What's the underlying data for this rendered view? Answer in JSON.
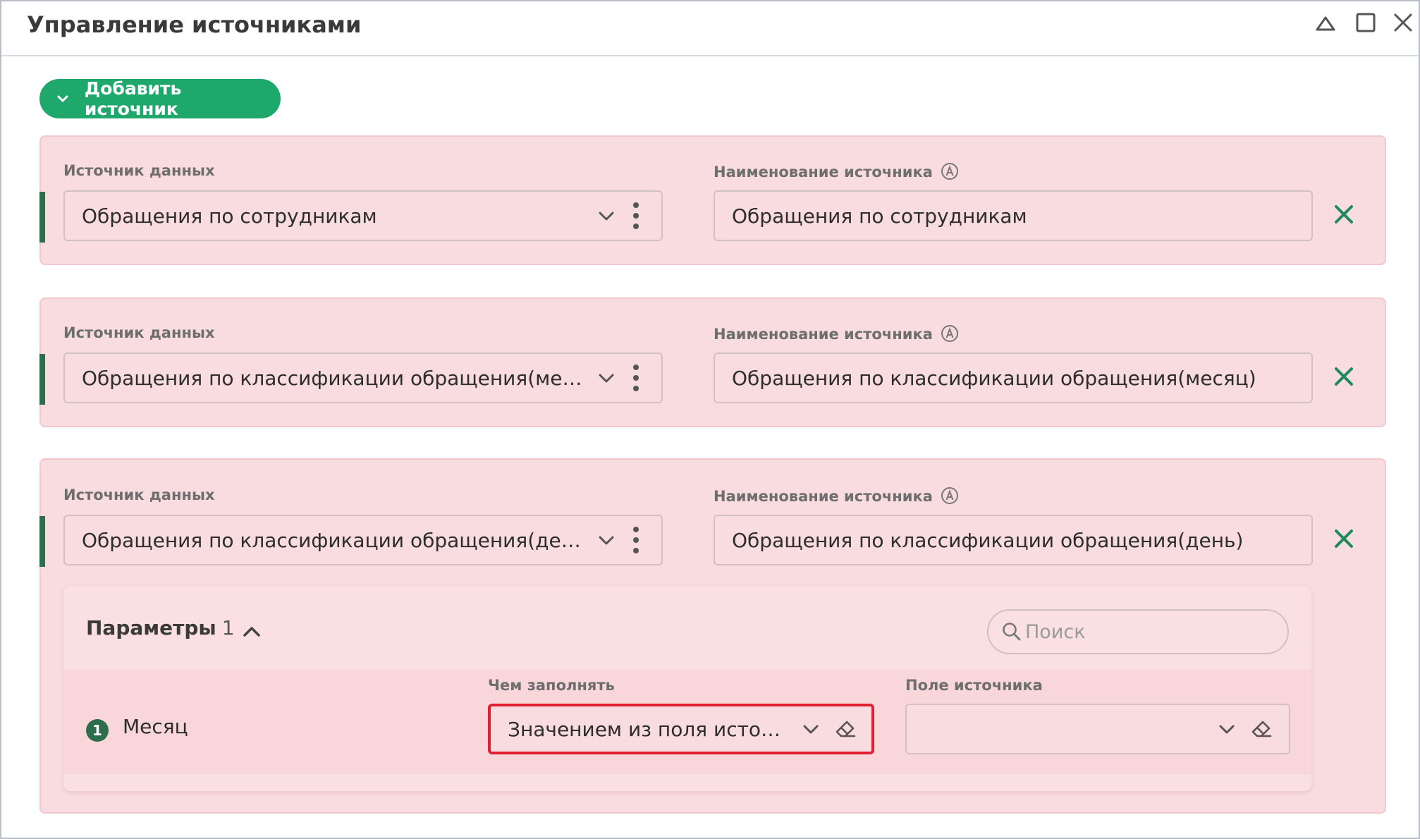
{
  "window": {
    "title": "Управление источниками"
  },
  "add_button": {
    "label": "Добавить источник"
  },
  "sources": [
    {
      "source_label": "Источник данных",
      "source_value": "Обращения по сотрудникам",
      "name_label": "Наименование источника",
      "name_value": "Обращения по сотрудникам"
    },
    {
      "source_label": "Источник данных",
      "source_value": "Обращения по классификации обращения(месяц)",
      "name_label": "Наименование источника",
      "name_value": "Обращения по классификации обращения(месяц)"
    },
    {
      "source_label": "Источник данных",
      "source_value": "Обращения по классификации обращения(день)",
      "name_label": "Наименование источника",
      "name_value": "Обращения по классификации обращения(день)"
    }
  ],
  "params": {
    "title": "Параметры",
    "count": "1",
    "search_placeholder": "Поиск",
    "fill_label": "Чем заполнять",
    "field_label": "Поле источника",
    "rows": [
      {
        "num": "1",
        "name": "Месяц",
        "fill_value": "Значением из поля источн…",
        "field_value": ""
      }
    ]
  },
  "colors": {
    "accent_green": "#1ea86c",
    "dark_green": "#2e6d4b",
    "card_bg": "#f9dcdf",
    "highlight_red": "#e02030"
  }
}
